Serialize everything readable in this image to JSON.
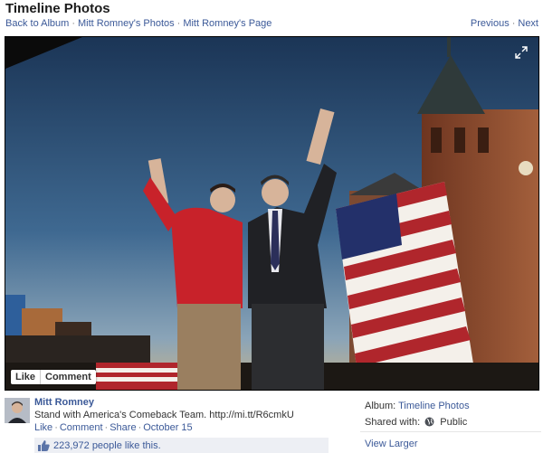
{
  "header": {
    "title": "Timeline Photos",
    "breadcrumb": {
      "back": "Back to Album",
      "sep1": "·",
      "photos": "Mitt Romney's Photos",
      "sep2": "·",
      "page": "Mitt Romney's Page"
    },
    "pager": {
      "previous": "Previous",
      "sep": "·",
      "next": "Next"
    }
  },
  "photo": {
    "actions": {
      "like": "Like",
      "comment": "Comment"
    },
    "icons": {
      "expand": "expand-icon"
    },
    "colors": {
      "sky": "#1e3a5c",
      "jacket_red": "#c8222a",
      "flag_red": "#b0262c",
      "flag_blue": "#23306a",
      "brick": "#8a4a30"
    }
  },
  "story": {
    "author": "Mitt Romney",
    "text": "Stand with America's Comeback Team.",
    "link": "http://mi.tt/R6cmkU",
    "meta": {
      "like": "Like",
      "dot1": "·",
      "comment": "Comment",
      "dot2": "·",
      "share": "Share",
      "dot3": "·",
      "date": "October 15"
    },
    "likes": "223,972 people like this."
  },
  "sidebar": {
    "album_label": "Album:",
    "album_value": "Timeline Photos",
    "shared_label": "Shared with:",
    "shared_value": "Public",
    "view_larger": "View Larger"
  }
}
